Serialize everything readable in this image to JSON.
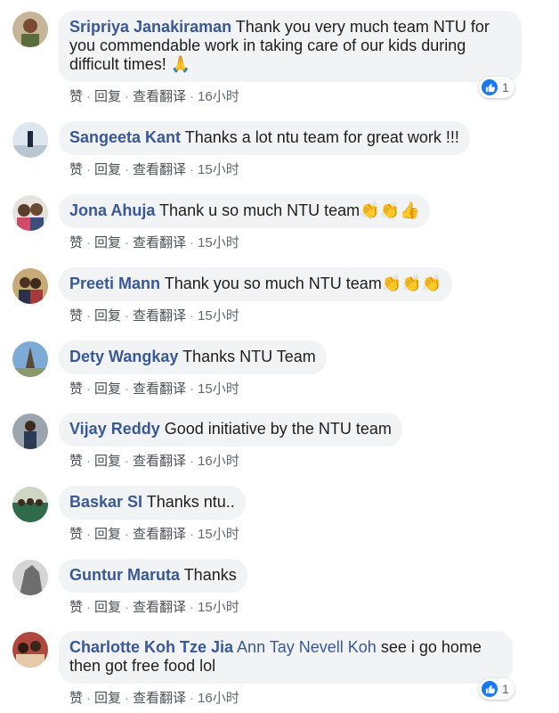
{
  "comments": [
    {
      "author": "Sripriya Janakiraman",
      "mention": "",
      "text": "Thank you very much team NTU for you commendable work in taking care of our kids during difficult times! 🙏",
      "like": "赞",
      "reply": "回复",
      "translate": "查看翻译",
      "time": "16小时",
      "reactions": "1"
    },
    {
      "author": "Sangeeta Kant",
      "mention": "",
      "text": "Thanks a lot ntu team for great work !!!",
      "like": "赞",
      "reply": "回复",
      "translate": "查看翻译",
      "time": "15小时",
      "reactions": ""
    },
    {
      "author": "Jona Ahuja",
      "mention": "",
      "text": "Thank u so much NTU team👏👏👍",
      "like": "赞",
      "reply": "回复",
      "translate": "查看翻译",
      "time": "15小时",
      "reactions": ""
    },
    {
      "author": "Preeti Mann",
      "mention": "",
      "text": "Thank you so much NTU team👏👏👏",
      "like": "赞",
      "reply": "回复",
      "translate": "查看翻译",
      "time": "15小时",
      "reactions": ""
    },
    {
      "author": "Dety Wangkay",
      "mention": "",
      "text": "Thanks NTU Team",
      "like": "赞",
      "reply": "回复",
      "translate": "查看翻译",
      "time": "15小时",
      "reactions": ""
    },
    {
      "author": "Vijay Reddy",
      "mention": "",
      "text": "Good initiative by the NTU team",
      "like": "赞",
      "reply": "回复",
      "translate": "查看翻译",
      "time": "16小时",
      "reactions": ""
    },
    {
      "author": "Baskar SI",
      "mention": "",
      "text": "Thanks ntu..",
      "like": "赞",
      "reply": "回复",
      "translate": "查看翻译",
      "time": "15小时",
      "reactions": ""
    },
    {
      "author": "Guntur Maruta",
      "mention": "",
      "text": "Thanks",
      "like": "赞",
      "reply": "回复",
      "translate": "查看翻译",
      "time": "15小时",
      "reactions": ""
    },
    {
      "author": "Charlotte Koh Tze Jia",
      "mention": "Ann Tay Nevell Koh",
      "text": "see i go home then got free food lol",
      "like": "赞",
      "reply": "回复",
      "translate": "查看翻译",
      "time": "16小时",
      "reactions": "1"
    }
  ],
  "colors": {
    "author": "#385898",
    "bubble": "#f2f3f5",
    "like": "#1877f2"
  },
  "icons": {
    "reaction": "like-thumb-icon",
    "separator": "·"
  }
}
